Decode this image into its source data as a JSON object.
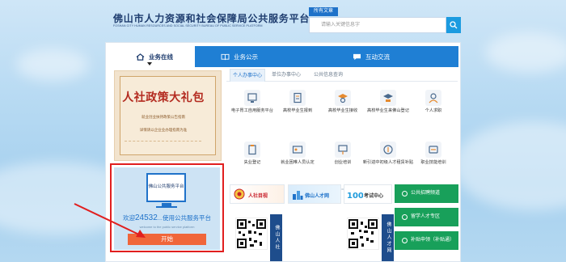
{
  "header": {
    "logo_cn": "佛山市人力资源和社会保障局公共服务平台",
    "logo_en": "FOSHAN CITY HUMAN RESOURCES AND SOCIAL SECURITY BUREAU OF PUBLIC SERVICE PLATFORM",
    "search_tab": "所有文章",
    "search_placeholder": "请输入关键信息字"
  },
  "top_tabs": [
    {
      "label": "业务在线",
      "icon": "home-icon"
    },
    {
      "label": "业务公示",
      "icon": "book-icon"
    },
    {
      "label": "互动交流",
      "icon": "chat-icon"
    }
  ],
  "banner": {
    "title": "人社政策大礼包",
    "sub1": "就业创业扶持政策公告指南",
    "sub2": "详情请以企业业办理指南为准"
  },
  "promo": {
    "monitor_text": "佛山公共服务平台",
    "count_prefix": "欢迎",
    "count": "24532",
    "count_suffix": "...使用公共服务平台",
    "count_sub": "welcome to the public service platform",
    "start_label": "开始"
  },
  "service_tabs": [
    "个人办事中心",
    "单位办事中心",
    "公共信息查询"
  ],
  "services": [
    {
      "label": "电子胃工自用服务平台",
      "icon": "terminal-icon"
    },
    {
      "label": "高校毕业生报到",
      "icon": "document-icon"
    },
    {
      "label": "高校毕业生接收",
      "icon": "graduate-icon"
    },
    {
      "label": "高校毕业生来佛山登记",
      "icon": "graduate-register-icon"
    },
    {
      "label": "个人求职",
      "icon": "person-icon"
    },
    {
      "label": "失业登记",
      "icon": "clipboard-icon"
    },
    {
      "label": "就业困难人员认定",
      "icon": "id-card-icon"
    },
    {
      "label": "创业培训",
      "icon": "training-icon"
    },
    {
      "label": "新引进中初级人才租赁补贴",
      "icon": "subsidy-icon"
    },
    {
      "label": "职业技能培训",
      "icon": "skill-icon"
    }
  ],
  "link_tiles": [
    {
      "label": "人社目视",
      "color": "#c8202a"
    },
    {
      "label": "佛山人才网",
      "color": "#1f72c9"
    },
    {
      "label": "考试中心",
      "color": "#1f72c9"
    }
  ],
  "green_buttons": [
    "公共招聘频道",
    "留学人才专区",
    "补贴申领（补贴通）"
  ],
  "qr_cards": [
    {
      "side_label": "佛山人社"
    },
    {
      "side_label": "佛山人才网"
    }
  ],
  "colors": {
    "primary": "#1f7fd4",
    "accent_red": "#e11f1f",
    "start_button": "#f0663a",
    "green": "#18a05a"
  }
}
